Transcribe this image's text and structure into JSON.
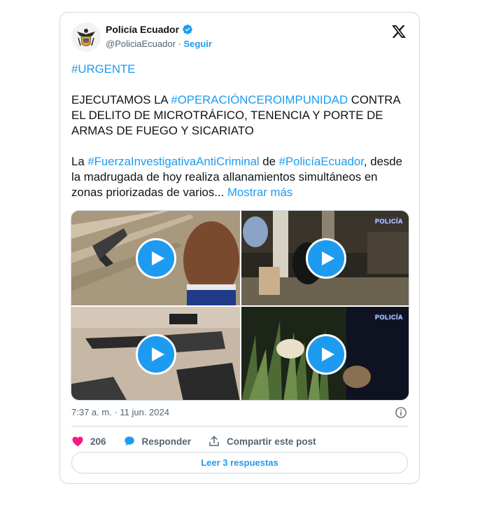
{
  "account": {
    "name": "Policía Ecuador",
    "handle": "@PoliciaEcuador",
    "separator": "·",
    "follow_label": "Seguir",
    "verified_color": "#1d9bf0"
  },
  "tweet": {
    "hashtag_urgent": "#URGENTE",
    "p1_text_a": "EJECUTAMOS LA ",
    "p1_tag": "#OPERACIÓNCEROIMPUNIDAD",
    "p1_text_b": " CONTRA EL DELITO DE MICROTRÁFICO, TENENCIA Y PORTE DE ARMAS DE FUEGO Y SICARIATO",
    "p2_text_a": "La ",
    "p2_tag1": "#FuerzaInvestigativaAntiCriminal",
    "p2_text_b": " de ",
    "p2_tag2": "#PolicíaEcuador",
    "p2_text_c": ", desde la madrugada de hoy realiza allanamientos simultáneos en zonas priorizadas de varios... ",
    "show_more": "Mostrar más"
  },
  "media": {
    "videos": [
      {
        "icon": "play-icon"
      },
      {
        "icon": "play-icon",
        "watermark": "POLICÍA"
      },
      {
        "icon": "play-icon"
      },
      {
        "icon": "play-icon",
        "watermark": "POLICÍA"
      }
    ]
  },
  "meta": {
    "timestamp": "7:37 a. m. · 11 jun. 2024",
    "info_icon": "info-icon"
  },
  "actions": {
    "likes": "206",
    "reply_label": "Responder",
    "share_label": "Compartir este post",
    "like_color": "#f91880",
    "reply_color": "#1d9bf0"
  },
  "read_replies": "Leer 3 respuestas",
  "colors": {
    "accent": "#1d9bf0",
    "text": "#0f1419",
    "muted": "#536471",
    "border": "#cfd9de"
  }
}
